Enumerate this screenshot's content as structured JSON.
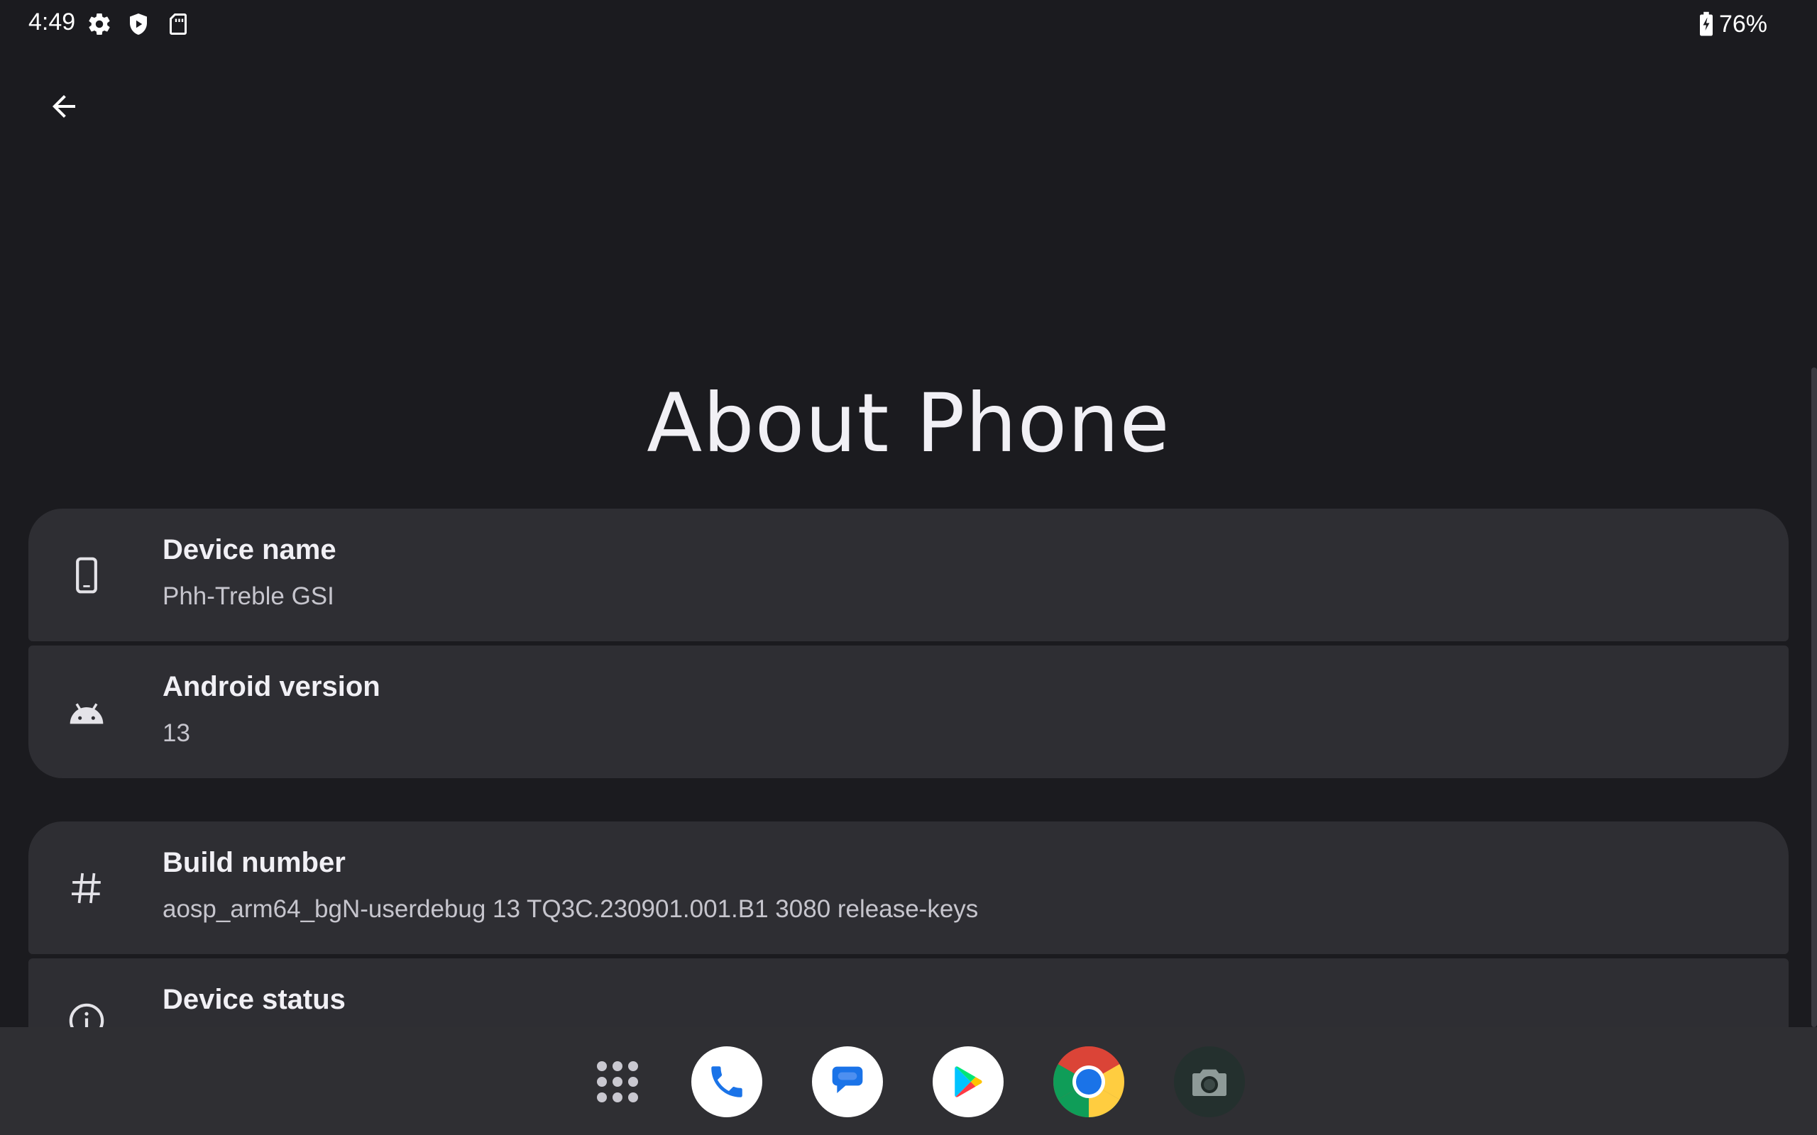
{
  "status_bar": {
    "time": "4:49",
    "icons": [
      "settings-gear-icon",
      "shield-play-icon",
      "sd-card-icon"
    ],
    "battery_percent": "76%"
  },
  "header": {
    "back_icon": "arrow-back-icon"
  },
  "page": {
    "title": "About Phone"
  },
  "settings": [
    {
      "icon": "smartphone-icon",
      "title": "Device name",
      "summary": "Phh-Treble GSI"
    },
    {
      "icon": "android-icon",
      "title": "Android version",
      "summary": "13"
    },
    {
      "icon": "hash-icon",
      "title": "Build number",
      "summary": "aosp_arm64_bgN-userdebug 13 TQ3C.230901.001.B1 3080 release-keys"
    },
    {
      "icon": "info-icon",
      "title": "Device status",
      "summary": ""
    }
  ],
  "taskbar": {
    "apps": [
      "Phone",
      "Messages",
      "Play Store",
      "Chrome",
      "Camera"
    ],
    "drawer_icon": "app-drawer-icon"
  },
  "colors": {
    "background": "#1b1b1f",
    "card": "#2e2e33",
    "taskbar": "#2f2f33",
    "accent_blue": "#1a73e8"
  }
}
